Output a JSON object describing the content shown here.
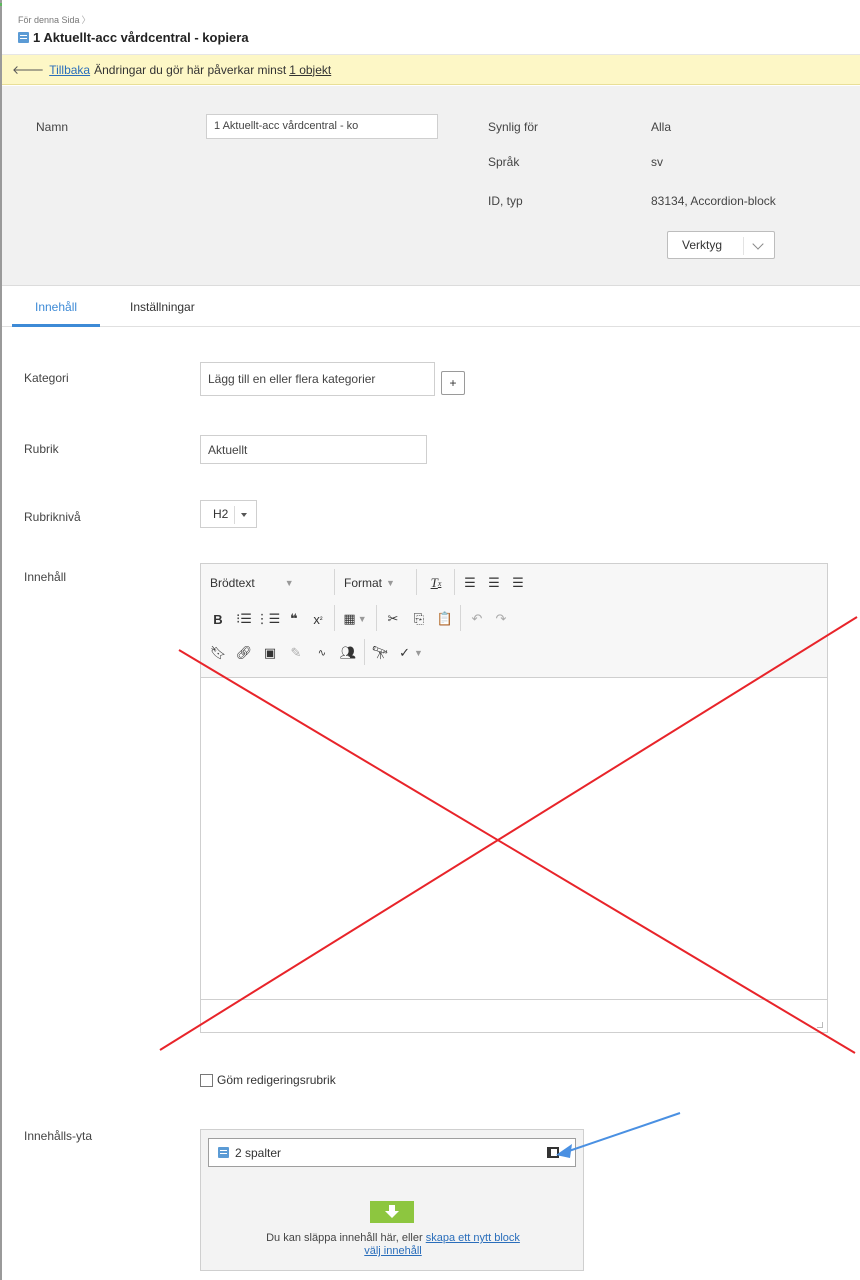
{
  "breadcrumb": {
    "label": "För denna Sida"
  },
  "page": {
    "title": "1 Aktuellt-acc vårdcentral - kopiera"
  },
  "notice": {
    "back_link": "Tillbaka",
    "message": "Ändringar du gör här påverkar minst",
    "objects_link": "1 objekt"
  },
  "info": {
    "name_label": "Namn",
    "name_value": "1 Aktuellt-acc vårdcentral - ko",
    "visible_label": "Synlig för",
    "visible_value": "Alla",
    "language_label": "Språk",
    "language_value": "sv",
    "id_label": "ID, typ",
    "id_value": "83134, Accordion-block",
    "tools_button": "Verktyg"
  },
  "tabs": [
    {
      "label": "Innehåll",
      "active": true
    },
    {
      "label": "Inställningar",
      "active": false
    }
  ],
  "form": {
    "category_label": "Kategori",
    "category_value": "Lägg till en eller flera kategorier",
    "add_button": "+",
    "heading_label": "Rubrik",
    "heading_value": "Aktuellt",
    "heading_level_label": "Rubriknivå",
    "heading_level_value": "H2",
    "content_label": "Innehåll",
    "hide_heading_label": "Göm redigeringsrubrik",
    "content_area_label": "Innehålls-yta"
  },
  "editor": {
    "paragraph_format": "Brödtext",
    "format_menu": "Format"
  },
  "content_area": {
    "item_label": "2 spalter",
    "drop_text": "Du kan släppa innehåll här, eller",
    "create_link": "skapa ett nytt block",
    "choose_link": "välj innehåll"
  },
  "colors": {
    "accent": "#3d8ad6",
    "notice_bg": "#fdf7c6",
    "panel_bg": "#f1f1f1",
    "annotation_red": "#e8242a",
    "annotation_blue": "#4a90e2",
    "drop_green": "#8dc63f"
  }
}
